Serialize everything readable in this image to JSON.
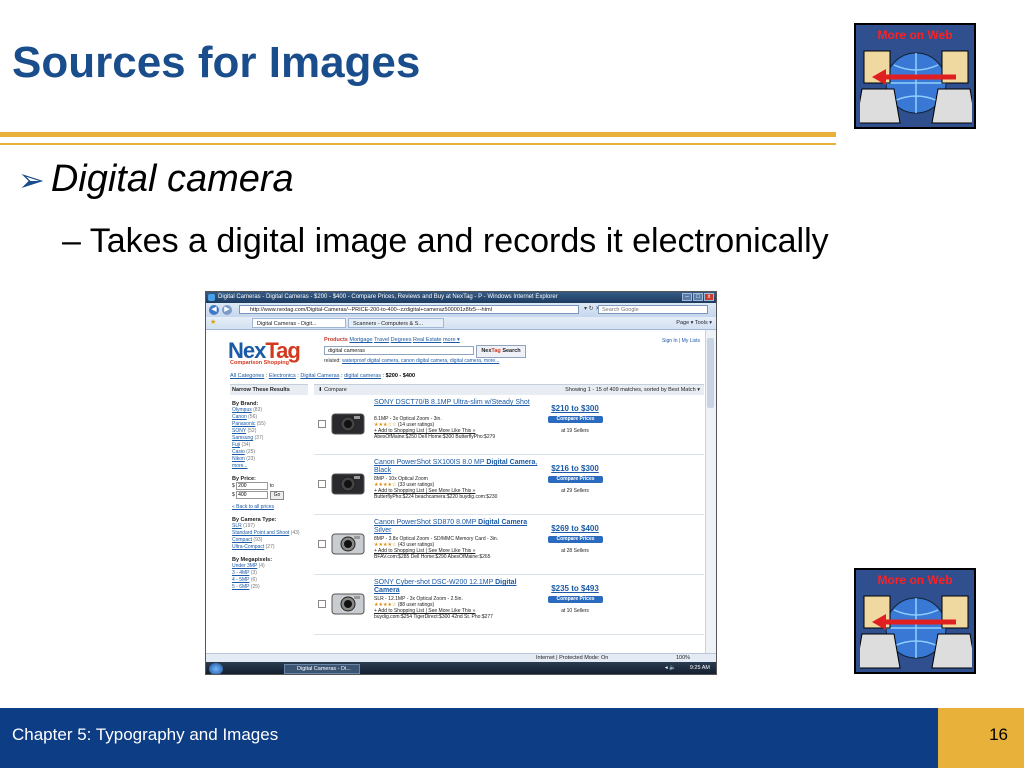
{
  "slide": {
    "title": "Sources for Images",
    "bullet1": "Digital camera",
    "bullet2": "Takes a digital image and records it electronically",
    "web_icon_label": "More on Web",
    "footer_text": "Chapter 5: Typography and Images",
    "page_number": "16",
    "colors": {
      "title": "#1a4d8c",
      "footer": "#0d3d84",
      "gold": "#e8b13a"
    }
  },
  "browser": {
    "title": "Digital Cameras - Digital Cameras - $200 - $400 - Compare Prices, Reviews and Buy at NexTag - P - Windows Internet Explorer",
    "url": "http://www.nextag.com/Digital-Cameras/--PRICE-200-to-400--zzdigital+cameraz500001z8fz5---html",
    "search_placeholder": "Search Google",
    "tabs": [
      "Digital Cameras - Digit...",
      "Scanners - Computers & S..."
    ],
    "tools": "Page ▾   Tools ▾",
    "status_zone": "Internet | Protected Mode: On",
    "zoom": "100%",
    "taskbar_item": "Digital Cameras - Di...",
    "clock": "9:25 AM"
  },
  "site": {
    "logo_a": "Nex",
    "logo_b": "Tag",
    "logo_sub": "Comparison Shopping",
    "topnav": [
      "Products",
      "Mortgage",
      "Travel",
      "Degrees",
      "Real Estate",
      "more ▾"
    ],
    "signin": "Sign In | My Lists",
    "query": "digital cameras",
    "search_btn_a": "Nex",
    "search_btn_b": "Tag",
    "search_btn_c": " Search",
    "related_label": "related:",
    "related_links": "waterproof digital camera,  canon digital camera,  digital camera,   more...",
    "crumbs": [
      "All Categories",
      "Electronics",
      "Digital Cameras",
      "digital cameras"
    ],
    "crumb_last": "$200 - $400",
    "sidebar": {
      "head": "Narrow These Results",
      "brand_label": "By Brand:",
      "brands": [
        {
          "name": "Olympus",
          "count": "(83)"
        },
        {
          "name": "Canon",
          "count": "(56)"
        },
        {
          "name": "Panasonic",
          "count": "(55)"
        },
        {
          "name": "SONY",
          "count": "(52)"
        },
        {
          "name": "Samsung",
          "count": "(37)"
        },
        {
          "name": "Fuji",
          "count": "(34)"
        },
        {
          "name": "Casio",
          "count": "(25)"
        },
        {
          "name": "Nikon",
          "count": "(23)"
        },
        {
          "name": "more...",
          "count": ""
        }
      ],
      "price_label": "By Price:",
      "price_from": "200",
      "price_to_word": "to",
      "price_to": "400",
      "currency": "$",
      "go": "Go",
      "back_prices": "« Back to all prices",
      "type_label": "By Camera Type:",
      "types": [
        {
          "name": "SLR",
          "count": "(197)"
        },
        {
          "name": "Standard Point and Shoot",
          "count": "(43)"
        },
        {
          "name": "Compact",
          "count": "(93)"
        },
        {
          "name": "Ultra-Compact",
          "count": "(27)"
        }
      ],
      "mp_label": "By Megapixels:",
      "megapixels": [
        {
          "name": "Under 3MP",
          "count": "(4)"
        },
        {
          "name": "3 - 4MP",
          "count": "(3)"
        },
        {
          "name": "4 - 5MP",
          "count": "(6)"
        },
        {
          "name": "5 - 6MP",
          "count": "(25)"
        }
      ]
    },
    "compare_label": "⬇ Compare",
    "showing": "Showing 1 - 15 of 409 matches, sorted by Best Match ▾",
    "results": [
      {
        "title_a": "SONY DSCT70/B 8.1MP Ultra-slim w/Steady Shot",
        "title_b": "",
        "title_c": "",
        "spec1": "8.1MP - 3x Optical Zoom - 3in.",
        "stars": "★★★☆☆",
        "ratings": "(14 user ratings)",
        "links": "+ Add to Shopping List  |  See More Like This »",
        "prices": "AbesOfMaine:$250  Dell Home:$300  ButterflyPho:$279",
        "price": "$210 to $300",
        "compare": "Compare Prices",
        "sellers": "at 19 Sellers"
      },
      {
        "title_a": "Canon PowerShot SX100IS 8.0 MP ",
        "title_b": "Digital Camera",
        "title_c": ", Black",
        "spec1": "8MP - 10x Optical Zoom",
        "stars": "★★★★☆",
        "ratings": "(33 user ratings)",
        "links": "+ Add to Shopping List  |  See More Like This »",
        "prices": "ButterflyPho:$224  beachcamera:$220  buydig.com:$230",
        "price": "$216 to $300",
        "compare": "Compare Prices",
        "sellers": "at 29 Sellers"
      },
      {
        "title_a": "Canon PowerShot SD870 8.0MP ",
        "title_b": "Digital Camera",
        "title_c": " Silver",
        "spec1": "8MP - 3.8x Optical Zoom - SD/MMC Memory Card - 3in.",
        "stars": "★★★★☆",
        "ratings": "(43 user ratings)",
        "links": "+ Add to Shopping List  |  See More Like This »",
        "prices": "BFAV.com:$285  Dell Home:$290  AbesOfMaine:$265",
        "price": "$269 to $400",
        "compare": "Compare Prices",
        "sellers": "at 28 Sellers"
      },
      {
        "title_a": "SONY Cyber-shot DSC-W200 12.1MP ",
        "title_b": "Digital Camera",
        "title_c": "",
        "spec1": "SLR - 12.1MP - 3x Optical Zoom - 2.5in.",
        "stars": "★★★★☆",
        "ratings": "(88 user ratings)",
        "links": "+ Add to Shopping List  |  See More Like This »",
        "prices": "buydig.com:$254  TigerDirect:$300  42nd St. Pho:$277",
        "price": "$235 to $493",
        "compare": "Compare Prices",
        "sellers": "at 10 Sellers"
      }
    ]
  }
}
